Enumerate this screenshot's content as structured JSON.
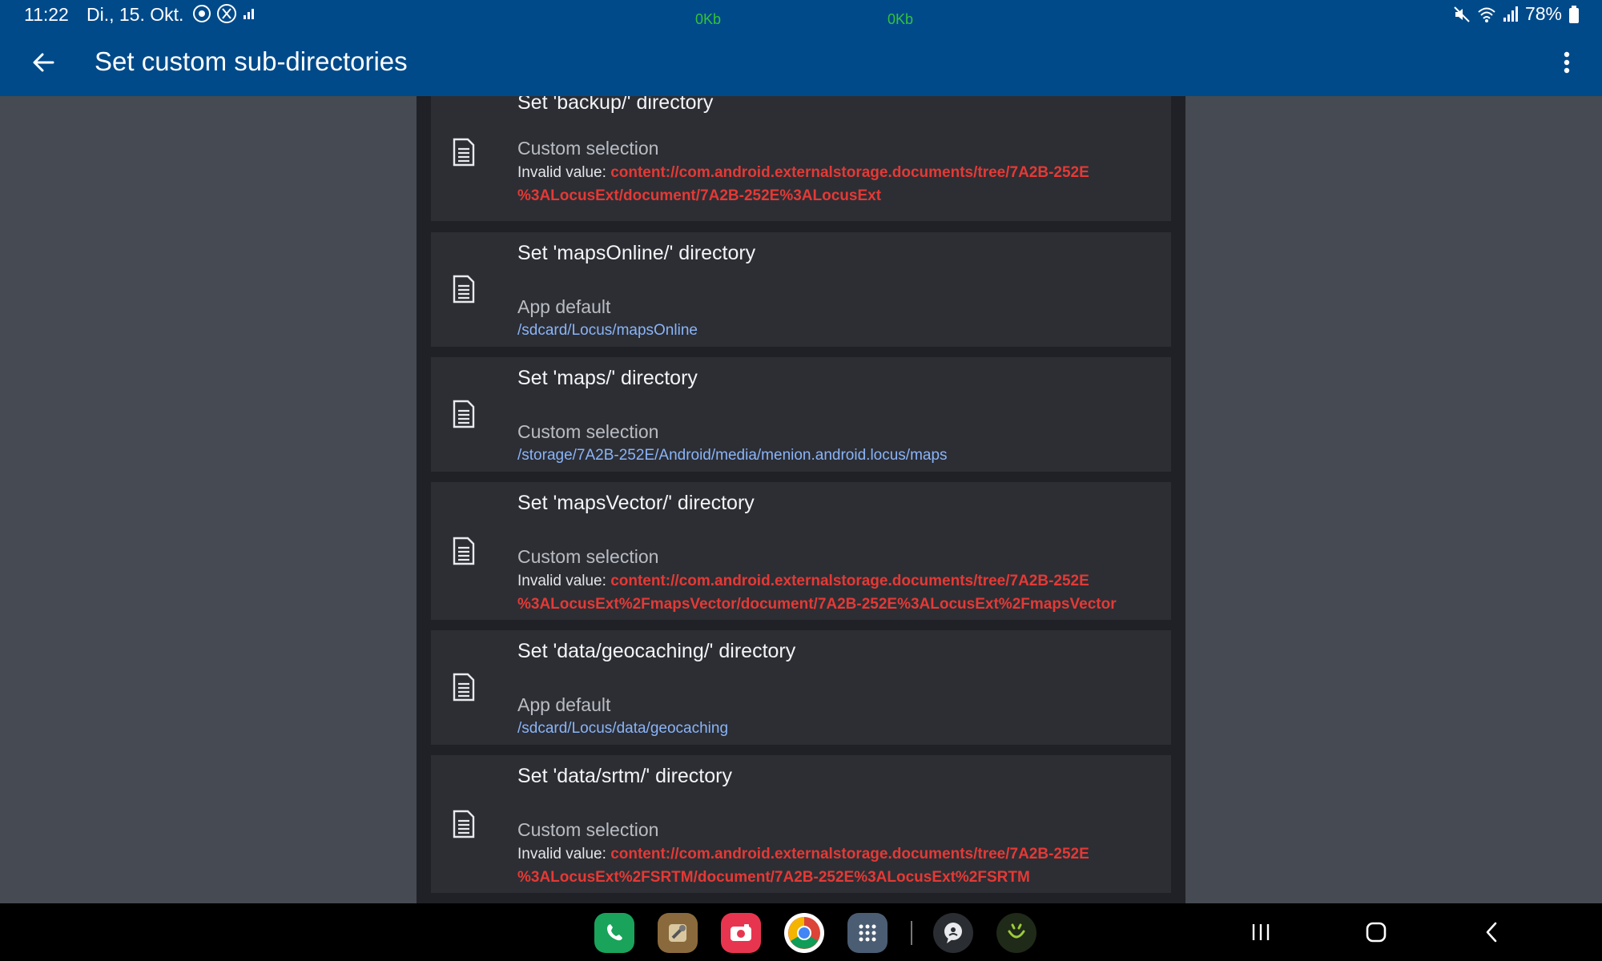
{
  "status_bar": {
    "time": "11:22",
    "date": "Di., 15. Okt.",
    "net_down": "0Kb",
    "net_up": "0Kb",
    "battery": "78%"
  },
  "app_bar": {
    "title": "Set custom sub-directories"
  },
  "items": [
    {
      "title": "Set 'backup/' directory",
      "subtitle": "Custom selection",
      "value_label": "Invalid value: ",
      "value": "content://com.android.externalstorage.documents/tree/7A2B-252E%3ALocusExt/document/7A2B-252E%3ALocusExt",
      "value_line1": "content://com.android.externalstorage.documents/tree/7A2B-252E",
      "value_line2": "%3ALocusExt/document/7A2B-252E%3ALocusExt",
      "valid": false
    },
    {
      "title": "Set 'mapsOnline/' directory",
      "subtitle": "App default",
      "value": "/sdcard/Locus/mapsOnline",
      "valid": true
    },
    {
      "title": "Set 'maps/' directory",
      "subtitle": "Custom selection",
      "value": "/storage/7A2B-252E/Android/media/menion.android.locus/maps",
      "valid": true
    },
    {
      "title": "Set 'mapsVector/' directory",
      "subtitle": "Custom selection",
      "value_label": "Invalid value: ",
      "value_line1": "content://com.android.externalstorage.documents/tree/7A2B-252E",
      "value_line2": "%3ALocusExt%2FmapsVector/document/7A2B-252E%3ALocusExt%2FmapsVector",
      "valid": false
    },
    {
      "title": "Set 'data/geocaching/' directory",
      "subtitle": "App default",
      "value": "/sdcard/Locus/data/geocaching",
      "valid": true
    },
    {
      "title": "Set 'data/srtm/' directory",
      "subtitle": "Custom selection",
      "value_label": "Invalid value: ",
      "value_line1": "content://com.android.externalstorage.documents/tree/7A2B-252E",
      "value_line2": "%3ALocusExt%2FSRTM/document/7A2B-252E%3ALocusExt%2FSRTM",
      "valid": false
    }
  ],
  "dock_apps": [
    {
      "name": "phone",
      "color": "#1aa35a"
    },
    {
      "name": "tools",
      "color": "#8a6a3c"
    },
    {
      "name": "camera",
      "color": "#e8354f"
    },
    {
      "name": "chrome",
      "color": "#ffffff"
    },
    {
      "name": "app-drawer",
      "color": "#4b5d73"
    },
    {
      "name": "messenger",
      "color": "#2a2d31"
    },
    {
      "name": "smiley-app",
      "color": "#1f2a18"
    }
  ],
  "colors": {
    "primary": "#004a8a",
    "error": "#e53935",
    "link": "#8ab4f8",
    "net": "#35c23a"
  }
}
